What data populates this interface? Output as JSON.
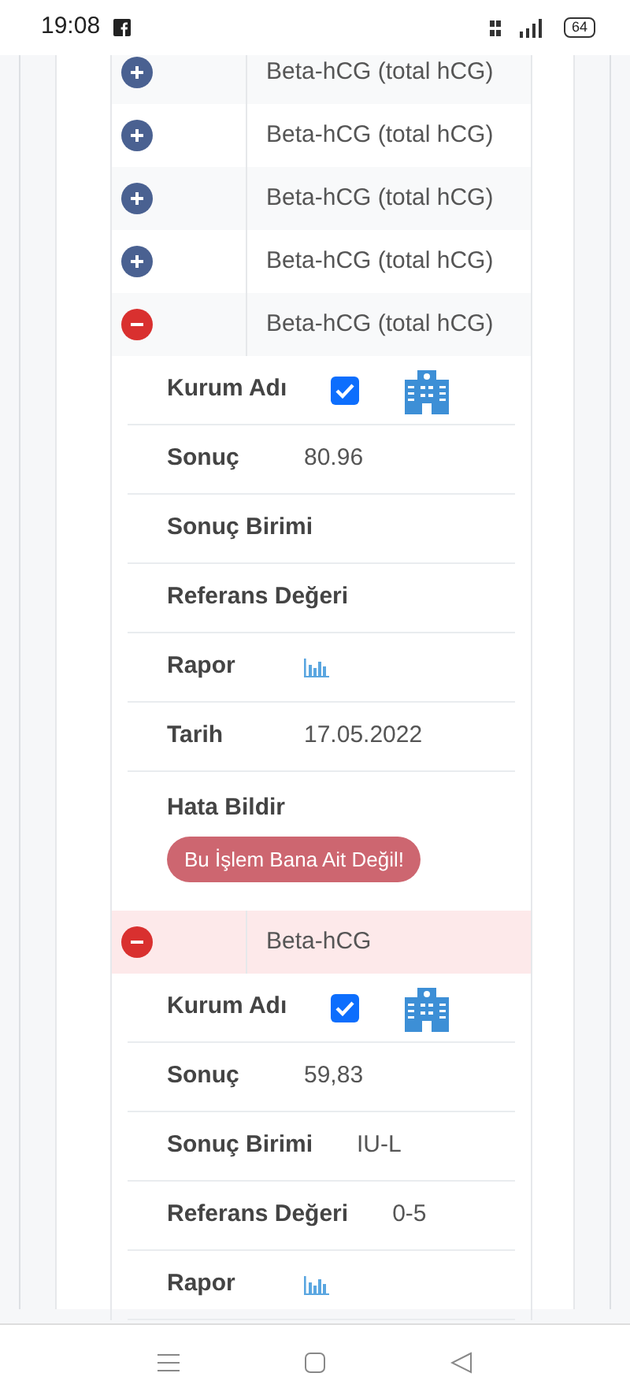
{
  "status_bar": {
    "time": "19:08",
    "battery": "64"
  },
  "records": [
    {
      "name": "Beta-hCG (total hCG)",
      "expanded": false,
      "selected": false
    },
    {
      "name": "Beta-hCG (total hCG)",
      "expanded": false,
      "selected": false
    },
    {
      "name": "Beta-hCG (total hCG)",
      "expanded": false,
      "selected": false
    },
    {
      "name": "Beta-hCG (total hCG)",
      "expanded": false,
      "selected": false
    },
    {
      "name": "Beta-hCG (total hCG)",
      "expanded": true,
      "selected": false,
      "details": [
        {
          "kind": "institution",
          "label": "Kurum Adı",
          "checked": true
        },
        {
          "kind": "text",
          "label": "Sonuç",
          "value": "80.96"
        },
        {
          "kind": "text",
          "label": "Sonuç Birimi"
        },
        {
          "kind": "text",
          "label": "Referans Değeri"
        },
        {
          "kind": "report",
          "label": "Rapor"
        },
        {
          "kind": "text",
          "label": "Tarih",
          "value": "17.05.2022"
        },
        {
          "kind": "error",
          "label": "Hata Bildir",
          "button": "Bu İşlem Bana Ait Değil!"
        }
      ]
    },
    {
      "name": "Beta-hCG",
      "expanded": true,
      "selected": true,
      "details": [
        {
          "kind": "institution",
          "label": "Kurum Adı",
          "checked": true
        },
        {
          "kind": "text",
          "label": "Sonuç",
          "value": "59,83"
        },
        {
          "kind": "text",
          "label": "Sonuç Birimi",
          "value": "IU-L"
        },
        {
          "kind": "text",
          "label": "Referans Değeri",
          "value": "0-5"
        },
        {
          "kind": "report",
          "label": "Rapor"
        }
      ]
    }
  ]
}
